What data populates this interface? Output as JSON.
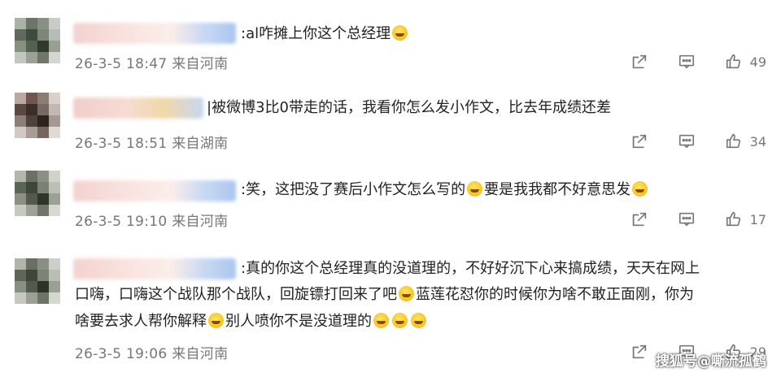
{
  "comments": [
    {
      "text_before": ":al咋摊上你这个总经理",
      "emojis": [
        "laugh-cry"
      ],
      "text_after": "",
      "meta": "26-3-5 18:47 来自河南",
      "likes": "49"
    },
    {
      "text_before": "|被微博3比0带走的话，我看你怎么发小作文，比去年成绩还差",
      "emojis": [],
      "text_after": "",
      "meta": "26-3-5 18:51 来自湖南",
      "likes": "34"
    },
    {
      "text_before": ":笑，这把没了赛后小作文怎么写的",
      "mid": "要是我我都不好意思发",
      "meta": "26-3-5 19:10 来自河南",
      "likes": "17"
    },
    {
      "line1": ":真的你这个总经理真的没道理的，不好好沉下心来搞成绩，天天在网上",
      "line2a": "口嗨，口嗨这个战队那个战队，回旋镖打回来了吧",
      "line2b": "蓝莲花怼你的时候你为啥不敢正面刚，你为",
      "line3a": "啥要去求人帮你解释",
      "line3b": "别人喷你不是没道理的",
      "meta": "26-3-5 19:06 来自河南",
      "likes": "29"
    }
  ],
  "watermark": "搜狐号@嘶流孤鹤",
  "colors": {
    "meta": "#777777",
    "text": "#222222",
    "emoji": "#f6c21a"
  },
  "icons": [
    "share-icon",
    "comment-icon",
    "like-icon"
  ]
}
